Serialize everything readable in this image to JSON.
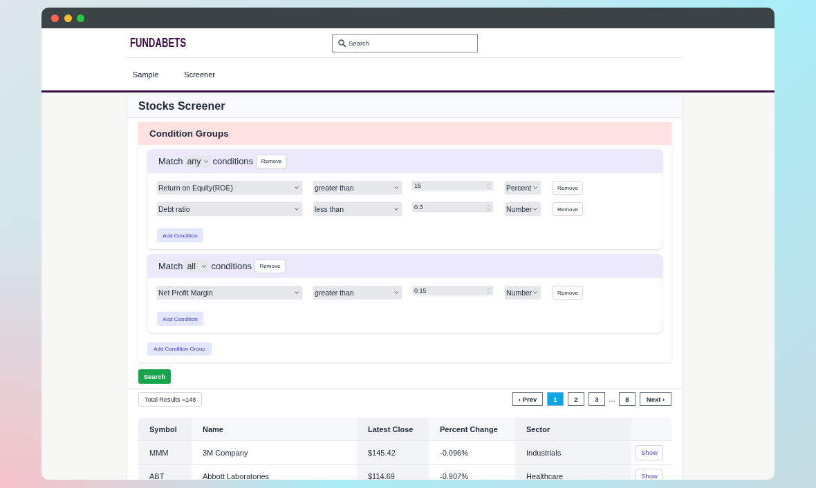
{
  "header": {
    "logo": "FUNDABETS",
    "search": {
      "placeholder": "Search"
    },
    "nav": [
      {
        "label": "Sample"
      },
      {
        "label": "Screener"
      }
    ]
  },
  "screener": {
    "title": "Stocks Screener",
    "condition_groups": {
      "title": "Condition Groups",
      "groups": [
        {
          "match_label": "Match",
          "match": "any",
          "conditions_label": "conditions",
          "remove_button": "Remove",
          "conditions": [
            {
              "field": "Return on Equity(ROE)",
              "operator": "greater than",
              "value": "15",
              "unit": "Percent",
              "remove_button": "Remove"
            },
            {
              "field": "Debt ratio",
              "operator": "less than",
              "value": "0.3",
              "unit": "Number",
              "remove_button": "Remove"
            }
          ],
          "add_button": "Add Condition"
        },
        {
          "match_label": "Match",
          "match": "all",
          "conditions_label": "conditions",
          "remove_button": "Remove",
          "conditions": [
            {
              "field": "Net Profit Margin",
              "operator": "greater than",
              "value": "0.15",
              "unit": "Number",
              "remove_button": "Remove"
            }
          ],
          "add_button": "Add Condition"
        }
      ],
      "add_group_button": "Add Condition Group"
    },
    "search_button": "Search"
  },
  "results": {
    "total": "Total Results =148",
    "pagination": [
      {
        "kind": "prev",
        "label": "‹ Prev",
        "selected": false
      },
      {
        "kind": "page",
        "label": "1",
        "selected": true
      },
      {
        "kind": "page",
        "label": "2",
        "selected": false
      },
      {
        "kind": "page",
        "label": "3",
        "selected": false
      },
      {
        "kind": "gap",
        "label": "…",
        "selected": false
      },
      {
        "kind": "page",
        "label": "8",
        "selected": false
      },
      {
        "kind": "next",
        "label": "Next ›",
        "selected": false
      }
    ],
    "table": {
      "columns": [
        "Symbol",
        "Name",
        "Latest Close",
        "Percent Change",
        "Sector"
      ],
      "rows": [
        {
          "cells": [
            "MMM",
            "3M Company",
            "$145.42",
            "-0.096%",
            "Industrials"
          ],
          "action": "Show"
        },
        {
          "cells": [
            "ABT",
            "Abbott Laboratories",
            "$114.69",
            "-0.907%",
            "Healthcare"
          ],
          "action": "Show"
        }
      ]
    }
  }
}
